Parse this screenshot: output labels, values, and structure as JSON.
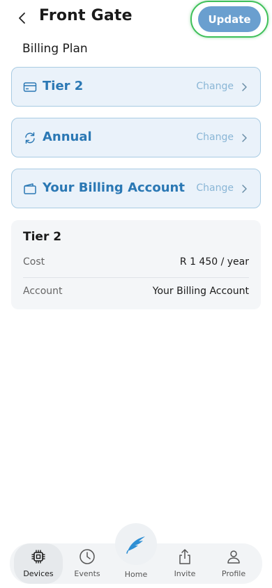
{
  "header": {
    "title": "Front Gate",
    "update_label": "Update"
  },
  "section": {
    "label": "Billing Plan"
  },
  "options": [
    {
      "label": "Tier 2",
      "change": "Change",
      "icon": "credit-card-icon"
    },
    {
      "label": "Annual",
      "change": "Change",
      "icon": "refresh-icon"
    },
    {
      "label": "Your Billing Account",
      "change": "Change",
      "icon": "wallet-icon"
    }
  ],
  "summary": {
    "title": "Tier 2",
    "cost_label": "Cost",
    "cost_value": "R 1 450 / year",
    "account_label": "Account",
    "account_value": "Your Billing Account"
  },
  "tabbar": {
    "devices": "Devices",
    "events": "Events",
    "home": "Home",
    "invite": "Invite",
    "profile": "Profile"
  },
  "colors": {
    "accent": "#2b78b4",
    "update_button": "#6a9fcf",
    "highlight_ring": "#3fc05a",
    "card_bg": "#eaf2fa"
  }
}
